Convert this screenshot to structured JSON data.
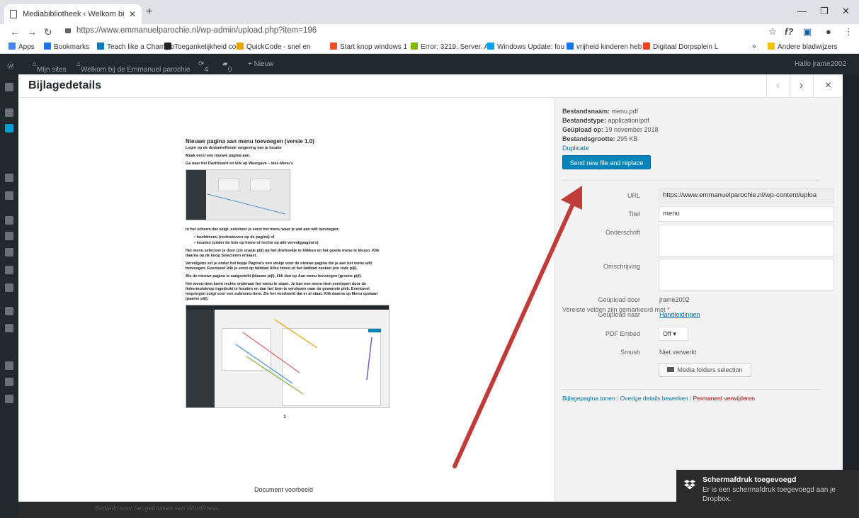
{
  "browser": {
    "tab_title": "Mediabibliotheek ‹ Welkom bij d",
    "url": "https://www.emmanuelparochie.nl/wp-admin/upload.php?item=196",
    "bookmarks": [
      {
        "label": "Apps",
        "icon": "apps-grid-icon",
        "color": "#4285f4"
      },
      {
        "label": "Bookmarks",
        "icon": "star-icon",
        "color": "#1a73e8"
      },
      {
        "label": "Teach like a Champio",
        "icon": "trello-icon",
        "color": "#0079bf"
      },
      {
        "label": "Toegankelijkheid con",
        "icon": "note-icon",
        "color": "#222222"
      },
      {
        "label": "QuickCode - snel en",
        "icon": "shovel-icon",
        "color": "#e8a400"
      },
      {
        "label": "Start knop windows 1",
        "icon": "windows-icon",
        "color": "#f25022"
      },
      {
        "label": "Error: 3219. Server. A",
        "icon": "windows-icon",
        "color": "#7fba00"
      },
      {
        "label": "Windows Update: fou",
        "icon": "windows-icon",
        "color": "#00a4ef"
      },
      {
        "label": "vrijheid kinderen heb",
        "icon": "star-icon",
        "color": "#1a73e8"
      },
      {
        "label": "Digitaal Dorpsplein L",
        "icon": "joomla-icon",
        "color": "#f44321"
      }
    ],
    "bookmarks_more": "»",
    "other_bookmarks": "Andere bladwijzers"
  },
  "wpbar": {
    "my_sites": "Mijn sites",
    "site_name": "Welkom bij de Emmanuel parochie",
    "updates": "4",
    "comments": "0",
    "new": "+ Nieuw",
    "greeting": "Hallo jrame2002"
  },
  "modal": {
    "title": "Bijlagedetails",
    "prev": "‹",
    "next": "›",
    "close": "×"
  },
  "document": {
    "heading": "Nieuwe pagina aan menu toevoegen (versie 1.0)",
    "line1": "Login op de desbetreffende omgeving van je locatie",
    "line2": "Maak eerst een nieuwe pagina aan.",
    "line3": "Ga naar het Dashboard en klik op Weergave – kies Menu's",
    "line4": "In het scherm dat volgt, selecteer je eerst het menu waar je wat aan wilt toevoegen:",
    "bullet1": "hoofdmenu (rechtsboven op de pagina) of",
    "bullet2": "locaties (onder de foto op home of rechts op alle vervolgpagina's)",
    "para1": "Het menu selecteer je door (zie oranje pijl) op het driehoekje te klikken en het goede menu te kiezen. Klik daarna op de knop Selecteren ernaast.",
    "para2": "Vervolgens zet je onder het kopje Pagina's een vinkje voor de nieuwe pagina die je aan het menu wilt toevoegen. Eventueel klik je eerst op tabblad Alles tonen of het tabblad zoeken (zie rode pijl).",
    "para3": "Als de nieuwe pagina is aangevinkt (blauwe pijl), klik dan op Aan menu toevoegen (groene pijl).",
    "para4": "Het menu-item komt rechts onderaan het menu te staan. Je kan een menu-item verslepen door de linkermuisknop ingedrukt te houden en dan het item te verslepen naar de gewenste plek. Eventueel inspringen zorgt voor een submenu-item. Zie het voorbeeld dat er al staat. Klik daarna op Menu opslaan (paarse pijl).",
    "page_number": "1",
    "caption": "Document voorbeeld"
  },
  "details": {
    "filename_label": "Bestandsnaam:",
    "filename": "menu.pdf",
    "filetype_label": "Bestandstype:",
    "filetype": "application/pdf",
    "uploaded_label": "Geüpload op:",
    "uploaded": "19 november 2018",
    "size_label": "Bestandsgrootte:",
    "size": "295 KB",
    "duplicate": "Duplicate",
    "replace_button": "Send new file and replace"
  },
  "fields": {
    "url_label": "URL",
    "url_value": "https://www.emmanuelparochie.nl/wp-content/uploa",
    "title_label": "Titel",
    "title_value": "menu",
    "caption_label": "Onderschrift",
    "caption_value": "",
    "description_label": "Omschrijving",
    "description_value": "",
    "uploaded_by_label": "Geüpload door",
    "uploaded_by": "jrame2002",
    "uploaded_to_label": "Geüpload naar",
    "uploaded_to": "Handleidingen",
    "required_note": "Vereiste velden zijn gemarkeerd met",
    "required_star": "*",
    "pdf_embed_label": "PDF Embed",
    "pdf_embed_value": "Off",
    "smush_label": "Smush",
    "smush_value": "Niet verwerkt",
    "media_folders_button": "Media folders selection"
  },
  "actions": {
    "view": "Bijlagepagina tonen",
    "edit": "Overige details bewerken",
    "delete": "Permanent verwijderen"
  },
  "footer": {
    "thanks": "Bedankt voor het gebruiken van WordPress."
  },
  "toast": {
    "title": "Schermafdruk toegevoegd",
    "message": "Er is een schermafdruk toegevoegd aan je Dropbox."
  },
  "colors": {
    "annotation_arrow": "#c23b3b",
    "wp_dark": "#23282d",
    "wp_blue": "#0085ba"
  }
}
